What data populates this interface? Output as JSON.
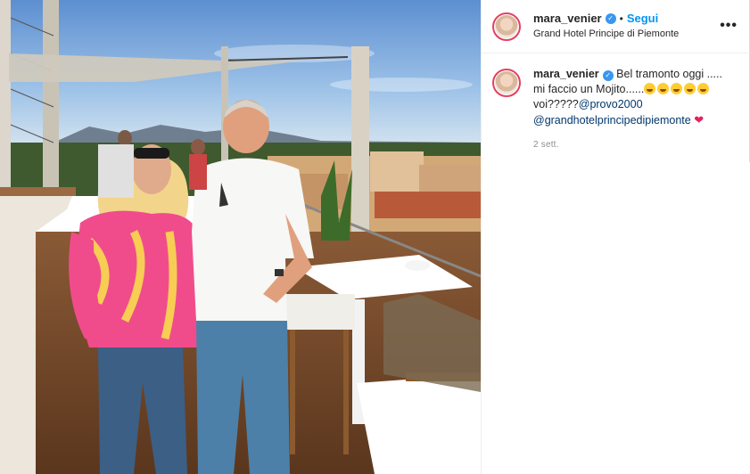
{
  "post": {
    "username": "mara_venier",
    "follow_label": "Segui",
    "separator": "•",
    "location": "Grand Hotel Principe di Piemonte",
    "more_label": "•••"
  },
  "caption": {
    "username": "mara_venier",
    "text_line1": "Bel tramonto oggi .....",
    "text_line2": "mi faccio un Mojito......",
    "text_line3": "voi?????",
    "mention_1": "@provo2000",
    "mention_2": "@grandhotelprincipedipiemonte",
    "emoji_count": 5,
    "time": "2 sett."
  },
  "icons": {
    "verified": "verified-badge-icon",
    "more": "more-options-icon",
    "heart": "red-heart-icon",
    "emoji": "grinning-squinting-face-icon"
  },
  "colors": {
    "follow": "#0095f6",
    "verified": "#3897f0",
    "mention": "#00376b",
    "time": "#8e8e8e",
    "story_ring": "#e4405f"
  }
}
